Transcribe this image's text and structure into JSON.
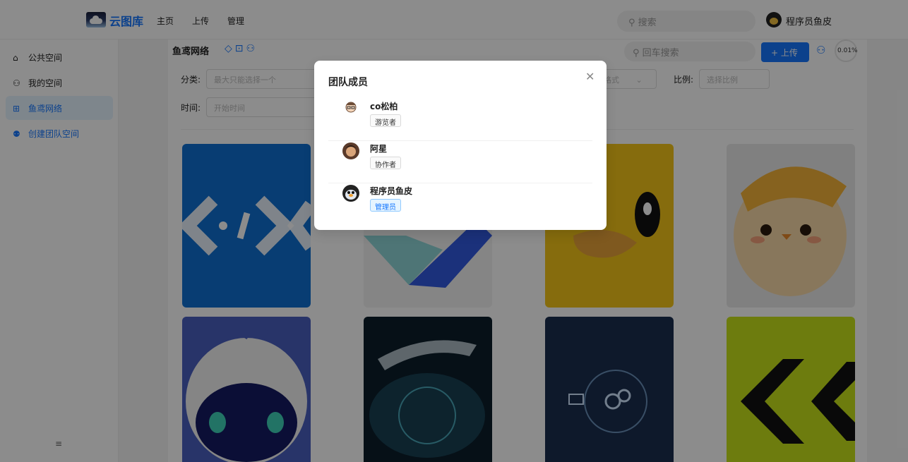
{
  "header": {
    "brand": "云图库",
    "nav": [
      "主页",
      "上传",
      "管理"
    ],
    "search_placeholder": "搜索",
    "user_name": "程序员鱼皮"
  },
  "sidebar": {
    "items": [
      {
        "label": "公共空间",
        "icon": "home-icon"
      },
      {
        "label": "我的空间",
        "icon": "user-icon"
      },
      {
        "label": "鱼鸢网络",
        "icon": "team-space-icon",
        "active": true
      },
      {
        "label": "创建团队空间",
        "icon": "team-add-icon"
      }
    ]
  },
  "space": {
    "title": "鱼鸢网络",
    "search_placeholder": "回车搜索",
    "upload_label": "+ 上传",
    "usage": "0.01%"
  },
  "filters": {
    "category_label": "分类:",
    "category_placeholder": "最大只能选择一个",
    "format_placeholder": "格式",
    "ratio_label": "比例:",
    "ratio_placeholder": "选择比例",
    "time_label": "时间:",
    "time_placeholder": "开始时间"
  },
  "modal": {
    "title": "团队成员",
    "members": [
      {
        "name": "co松柏",
        "role": "游览者"
      },
      {
        "name": "阿星",
        "role": "协作者"
      },
      {
        "name": "程序员鱼皮",
        "role": "管理员"
      }
    ]
  },
  "colors": {
    "accent": "#1677ff"
  }
}
